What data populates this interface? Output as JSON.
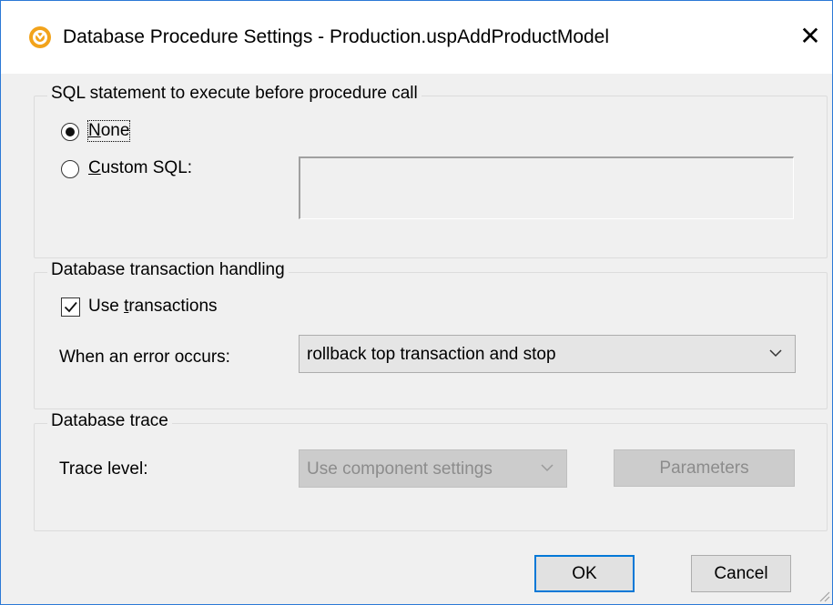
{
  "window": {
    "title": "Database Procedure Settings - Production.uspAddProductModel",
    "close_glyph": "✕",
    "accent_color": "#2b79d6",
    "app_icon": "mapforce-logo-icon"
  },
  "sql_group": {
    "legend": "SQL statement to execute before procedure call",
    "options": [
      {
        "label_first": "N",
        "label_rest": "one",
        "selected": true
      },
      {
        "label_first": "C",
        "label_rest": "ustom SQL:",
        "selected": false
      }
    ],
    "custom_sql_value": ""
  },
  "transaction_group": {
    "legend": "Database transaction handling",
    "use_transactions_prefix": "Use ",
    "use_transactions_underlined": "t",
    "use_transactions_rest": "ransactions",
    "use_transactions_checked": true,
    "error_label": "When an error occurs:",
    "error_value": "rollback top transaction and stop"
  },
  "trace_group": {
    "legend": "Database trace",
    "trace_label": "Trace level:",
    "trace_value": "Use component settings",
    "parameters_label": "Parameters"
  },
  "buttons": {
    "ok": "OK",
    "cancel": "Cancel"
  }
}
